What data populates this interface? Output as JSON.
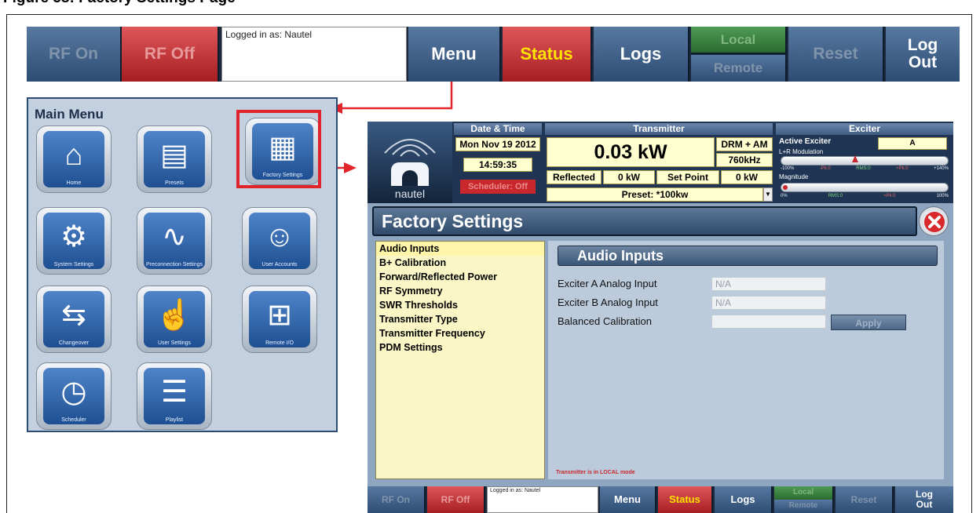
{
  "figure_caption": "Figure 58: Factory Settings Page",
  "top_bar": {
    "rf_on": "RF On",
    "rf_off": "RF Off",
    "logged_in": "Logged in as: Nautel",
    "menu": "Menu",
    "status": "Status",
    "logs": "Logs",
    "local": "Local",
    "remote": "Remote",
    "reset": "Reset",
    "logout_line1": "Log",
    "logout_line2": "Out"
  },
  "main_menu": {
    "title": "Main Menu",
    "items": [
      {
        "label": "Home",
        "icon": "house-icon"
      },
      {
        "label": "Presets",
        "icon": "folder-icon"
      },
      {
        "label": "Factory Settings",
        "icon": "factory-icon"
      },
      {
        "label": "System Settings",
        "icon": "gears-icon"
      },
      {
        "label": "Preconnection Settings",
        "icon": "txi-icon"
      },
      {
        "label": "User Accounts",
        "icon": "users-icon"
      },
      {
        "label": "Changeover",
        "icon": "changeover-icon"
      },
      {
        "label": "User Settings",
        "icon": "touch-icon"
      },
      {
        "label": "Remote I/O",
        "icon": "io-icon"
      },
      {
        "label": "Scheduler",
        "icon": "calendar-icon"
      },
      {
        "label": "Playlist",
        "icon": "playlist-icon"
      }
    ]
  },
  "screen": {
    "brand": "nautel",
    "date_time_header": "Date & Time",
    "date": "Mon Nov 19 2012",
    "time": "14:59:35",
    "scheduler": "Scheduler: Off",
    "transmitter_header": "Transmitter",
    "power": "0.03 kW",
    "mode": "DRM + AM",
    "frequency": "760kHz",
    "reflected_label": "Reflected",
    "reflected_value": "0 kW",
    "setpoint_label": "Set Point",
    "setpoint_value": "0 kW",
    "preset": "Preset: *100kw",
    "exciter_header": "Exciter",
    "active_exciter_label": "Active Exciter",
    "active_exciter_value": "A",
    "lr_modulation_label": "L+R Modulation",
    "lr_scale": [
      "-100%",
      "-Pk:0",
      "RMS:0",
      "+Pk:0",
      "+140%"
    ],
    "magnitude_label": "Magnitude",
    "mag_scale": [
      "0%",
      "RMS:0",
      "+Pk:0",
      "100%"
    ],
    "page_title": "Factory Settings",
    "nav_items": [
      "Audio Inputs",
      "B+ Calibration",
      "Forward/Reflected Power",
      "RF Symmetry",
      "SWR Thresholds",
      "Transmitter Type",
      "Transmitter Frequency",
      "PDM Settings"
    ],
    "section_title": "Audio Inputs",
    "fields": [
      {
        "label": "Exciter A Analog Input",
        "value": "N/A"
      },
      {
        "label": "Exciter B Analog Input",
        "value": "N/A"
      },
      {
        "label": "Balanced Calibration",
        "value": ""
      }
    ],
    "apply": "Apply",
    "status_msg": "Transmitter is in LOCAL mode"
  },
  "colors": {
    "accent_red": "#e0242a",
    "navy": "#2e4d74"
  }
}
